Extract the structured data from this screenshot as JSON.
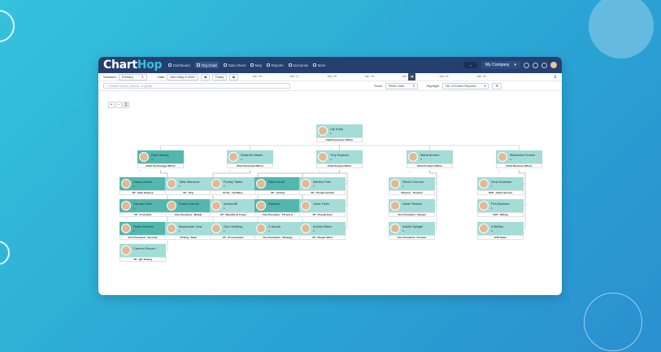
{
  "app": {
    "logo": {
      "main": "Chart",
      "accent": "Hop"
    },
    "nav": [
      {
        "label": "Dashboard",
        "icon": "home-icon",
        "active": false
      },
      {
        "label": "Org Chart",
        "icon": "org-chart-icon",
        "active": true
      },
      {
        "label": "Data Sheet",
        "icon": "sheet-icon",
        "active": false
      },
      {
        "label": "Map",
        "icon": "map-icon",
        "active": false
      },
      {
        "label": "Reports",
        "icon": "bar-chart-icon",
        "active": false
      },
      {
        "label": "Scenarios",
        "icon": "scenarios-icon",
        "active": false
      },
      {
        "label": "More",
        "icon": "more-icon",
        "active": false
      }
    ],
    "company": "My Company"
  },
  "toolbar": {
    "scenario_label": "Scenario",
    "scenario_value": "Primary",
    "date_label": "Date",
    "date_value": "Wed May 6 2020",
    "today_label": "Today",
    "timeline": [
      "Jan '16",
      "Jan '17",
      "Jan '18",
      "Jan '19",
      "Jan '20",
      "Jan '21",
      "Jan '22"
    ],
    "search_placeholder": "Search by job, person, or group",
    "show_label": "Show",
    "show_value": "Filled Jobs",
    "highlight_label": "Highlight",
    "highlight_value": "No. of Direct Reports"
  },
  "org": {
    "root": {
      "name": "Lily Karly",
      "count": "5",
      "title": "Chief Executive Officer",
      "dark": false
    },
    "vps": [
      {
        "name": "Dubi Harney",
        "count": "3",
        "title": "Chief Technology Officer",
        "dark": true,
        "reports": [
          {
            "name": "Danny Anime",
            "count": "2",
            "title": "VP - Data Science",
            "dark": true
          },
          {
            "name": "Garney Tebei",
            "count": "1",
            "title": "VP - Front End",
            "dark": true
          },
          {
            "name": "Fulbin Moreau",
            "count": "1",
            "title": "Vice President - Security",
            "dark": true
          },
          {
            "name": "Carmen Peluch",
            "count": "",
            "title": "VP - QA Testing",
            "dark": false
          }
        ]
      },
      {
        "name": "Roderich Maule",
        "count": "4",
        "title": "Chief Financial Officer",
        "dark": false,
        "reports": [
          {
            "name": "Tallis Warsona",
            "count": "2",
            "title": "VP - Eng",
            "dark": false
          },
          {
            "name": "Frankli Zaurek",
            "count": "",
            "title": "Vice President - Mobile",
            "dark": true
          },
          {
            "name": "Mackenzie Lima",
            "count": "1",
            "title": "VP Eng - Data",
            "dark": false
          }
        ]
      },
      {
        "name": "Trey Raybum",
        "count": "3",
        "title": "Chief People Officer",
        "dark": false,
        "reports": [
          {
            "name": "Franky Talbot",
            "count": "2",
            "title": "Sr Dir - Facilities",
            "dark": false
          },
          {
            "name": "Inmiba Bil",
            "count": "1",
            "title": "VP - Benefits & Comp",
            "dark": false
          },
          {
            "name": "Gov Lindberg",
            "count": "1",
            "title": "VP - Procurement",
            "dark": false
          },
          {
            "name": "Elian Hecht",
            "count": "",
            "title": "VP - Acctng",
            "dark": true
          },
          {
            "name": "Raethan",
            "count": "",
            "title": "Vice President - FP and A",
            "dark": true
          },
          {
            "name": "C Alcock",
            "count": "1",
            "title": "Vice President - Strategy",
            "dark": false
          },
          {
            "name": "Martine Pain",
            "count": "4",
            "title": "VP - People Central",
            "dark": false
          },
          {
            "name": "Gorie Frullo",
            "count": "",
            "title": "VP - People East",
            "dark": false
          },
          {
            "name": "Arvind Killam",
            "count": "1",
            "title": "VP - People West",
            "dark": false
          }
        ]
      },
      {
        "name": "Maria Bonera",
        "count": "3",
        "title": "Chief Product Officer",
        "dark": false,
        "reports": [
          {
            "name": "Rienzi Cerrosa",
            "count": "1",
            "title": "Director - Product",
            "dark": false
          },
          {
            "name": "Hazel Tenscie",
            "count": "",
            "title": "Vice President - Design",
            "dark": false
          },
          {
            "name": "Adolfo Spiegel",
            "count": "4",
            "title": "Vice President - Product",
            "dark": false
          }
        ]
      },
      {
        "name": "Madeoline Fearne",
        "count": "3",
        "title": "Chief Revenue Officer",
        "dark": false,
        "reports": [
          {
            "name": "Vera Grabman",
            "count": "1",
            "title": "SVP - Client Service",
            "dark": false
          },
          {
            "name": "Pen Bashore",
            "count": "1",
            "title": "SVP - Billing",
            "dark": false
          },
          {
            "name": "A Bellieu",
            "count": "3",
            "title": "SVP Sales",
            "dark": false
          }
        ]
      }
    ]
  }
}
